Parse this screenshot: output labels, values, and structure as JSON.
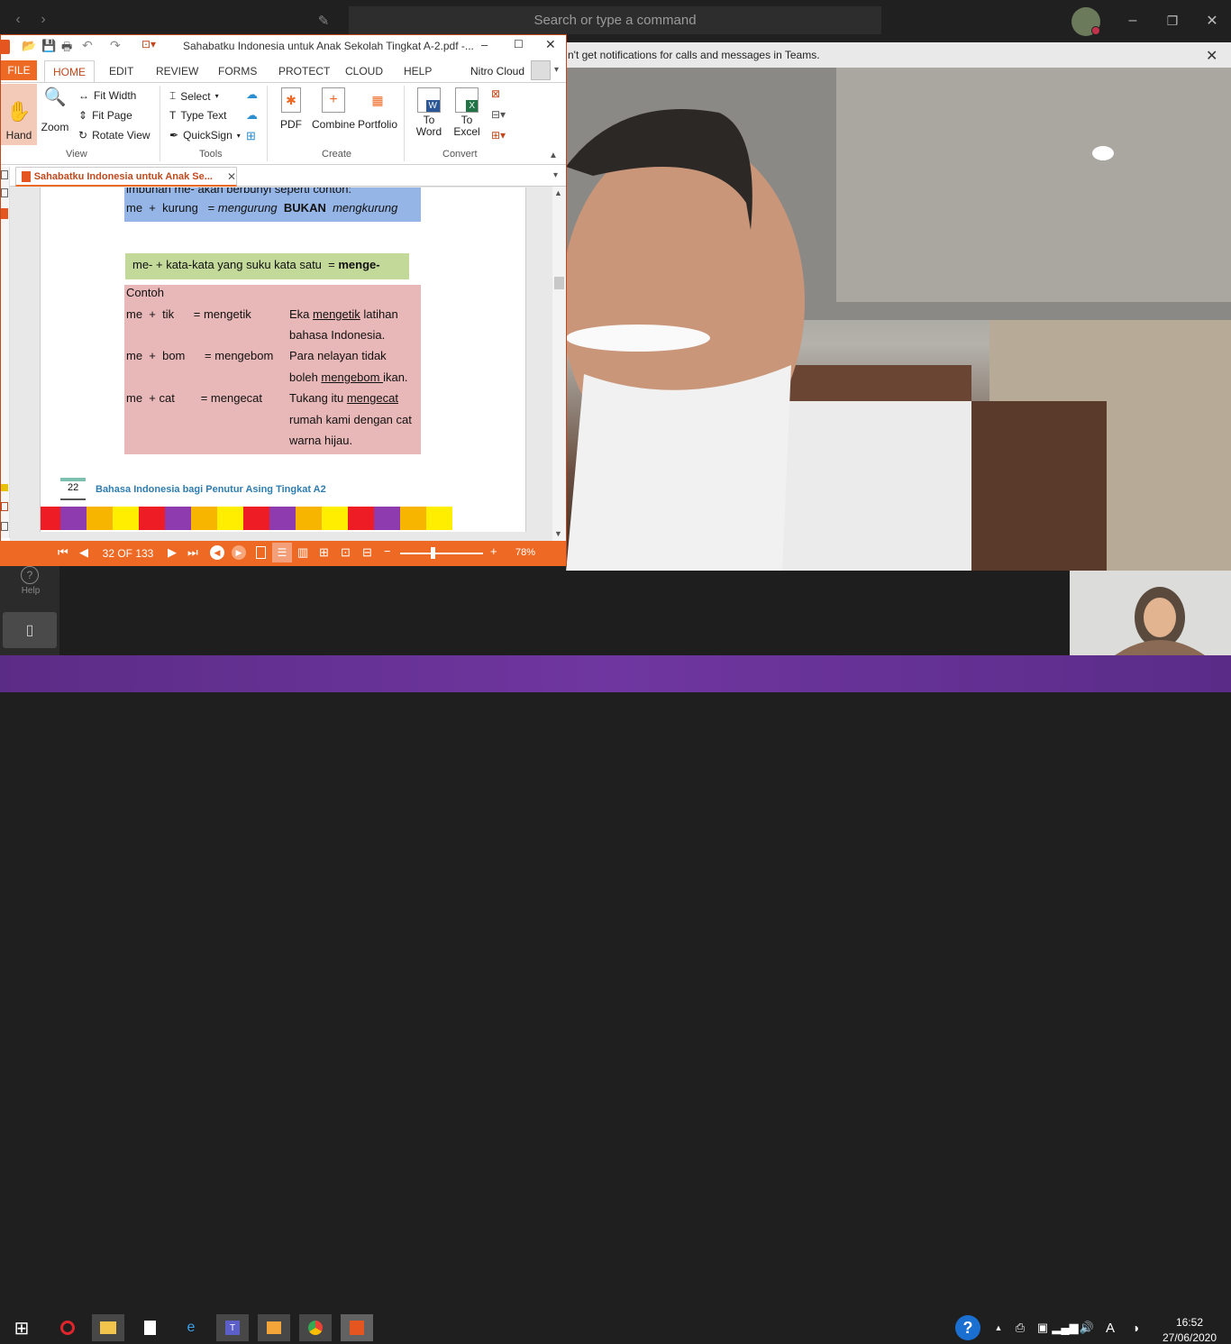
{
  "teams": {
    "search_placeholder": "Search or type a command",
    "notification": "n't get notifications for calls and messages in Teams.",
    "help_label": "Help"
  },
  "nitro": {
    "title": "Sahabatku Indonesia untuk Anak Sekolah Tingkat A-2.pdf -...",
    "tabs": [
      "FILE",
      "HOME",
      "EDIT",
      "REVIEW",
      "FORMS",
      "PROTECT",
      "CLOUD",
      "HELP"
    ],
    "account": "Nitro Cloud",
    "ribbon": {
      "hand": "Hand",
      "zoom": "Zoom",
      "fit_width": "Fit Width",
      "fit_page": "Fit Page",
      "rotate_view": "Rotate View",
      "view_group": "View",
      "select": "Select",
      "type_text": "Type Text",
      "quicksign": "QuickSign",
      "tools_group": "Tools",
      "pdf": "PDF",
      "combine": "Combine",
      "portfolio": "Portfolio",
      "create_group": "Create",
      "to_word": "To Word",
      "to_excel": "To Excel",
      "convert_group": "Convert"
    },
    "doc_tab": "Sahabatku Indonesia untuk Anak Se...",
    "page_content": {
      "top_line": "imbuhan me- akan berbunyi seperti contoh:",
      "ex_left": "me  +  kurung   = ",
      "ex_result": "mengurung",
      "ex_bukan": "BUKAN",
      "ex_wrong": "mengkurung",
      "rule": "me- + kata-kata yang suku kata satu  = ",
      "rule_bold": "menge-",
      "contoh": "Contoh",
      "ex1_formula": "me  +  tik      = mengetik",
      "ex1_s1a": "Eka ",
      "ex1_s1u": "mengetik",
      "ex1_s1b": " latihan",
      "ex1_s2": "bahasa Indonesia.",
      "ex2_formula": "me  +  bom      = mengebom",
      "ex2_s1": "Para nelayan tidak",
      "ex2_s2a": "boleh ",
      "ex2_s2u": "mengebom ",
      "ex2_s2b": "ikan.",
      "ex3_formula": "me  + cat        = mengecat",
      "ex3_s1a": "Tukang itu ",
      "ex3_s1u": "mengecat",
      "ex3_s2": "rumah kami dengan cat",
      "ex3_s3": "warna hijau.",
      "page_num": "22",
      "footer": "Bahasa Indonesia bagi Penutur Asing Tingkat A2"
    },
    "status": {
      "page_indicator": "32 OF 133",
      "zoom": "78%"
    }
  },
  "clock": {
    "time": "16:52",
    "date": "27/06/2020"
  },
  "colors": {
    "nitro_orange": "#ee6a24",
    "blue_box": "#94b5e6",
    "green_box": "#c3d99a",
    "pink_box": "#e8b7b7"
  }
}
